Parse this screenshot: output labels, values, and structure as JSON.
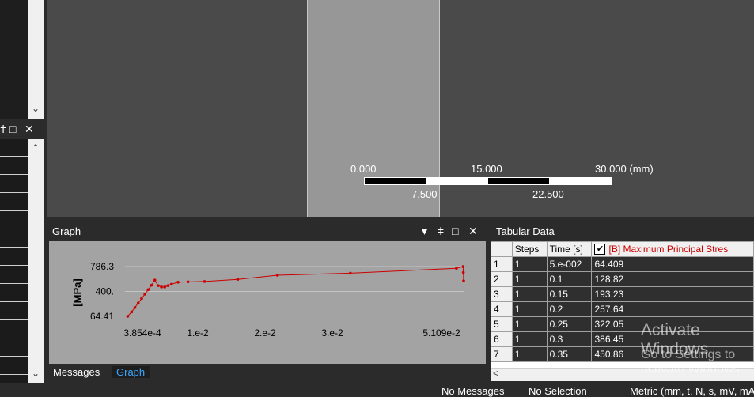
{
  "scale_bar": {
    "top_labels": [
      "0.000",
      "15.000",
      "30.000 (mm)"
    ],
    "bottom_labels": [
      "7.500",
      "22.500"
    ]
  },
  "graph_panel": {
    "title": "Graph",
    "controls": [
      "▾",
      "ǂ",
      "□",
      "✕"
    ],
    "tabs": [
      "Messages",
      "Graph"
    ]
  },
  "left_panel": {
    "controls": [
      "ǂ",
      "□",
      "✕"
    ],
    "scroll_down": "⌄",
    "scroll_up": "⌃"
  },
  "chart_data": {
    "type": "line",
    "ylabel": "[MPa]",
    "y_ticks": [
      "786.3",
      "400.",
      "64.41"
    ],
    "x_ticks": [
      "3.854e-4",
      "1.e-2",
      "2.e-2",
      "3.e-2",
      "5.109e-2"
    ],
    "xlim": [
      0.0,
      0.05109
    ],
    "ylim": [
      64.41,
      786.3
    ],
    "color": "#cc0000",
    "series": [
      {
        "x": [
          0.0004,
          0.001,
          0.0015,
          0.002,
          0.0025,
          0.003,
          0.0035,
          0.004,
          0.0045,
          0.005,
          0.0055,
          0.006,
          0.0065,
          0.007,
          0.008,
          0.0095,
          0.012,
          0.017,
          0.023,
          0.034,
          0.05,
          0.051,
          0.05105,
          0.05109
        ],
        "y": [
          64.4,
          128.8,
          193.2,
          257.6,
          322.1,
          386.5,
          450.9,
          515.3,
          590.0,
          510.0,
          490.0,
          490.0,
          510.0,
          530.0,
          560.0,
          565.0,
          570.0,
          600.0,
          660.0,
          690.0,
          760.0,
          786.3,
          700.0,
          580.0
        ]
      }
    ]
  },
  "tabular_panel": {
    "title": "Tabular Data",
    "headers": [
      "Steps",
      "Time [s]",
      "[B] Maximum Principal Stres"
    ],
    "checkbox": "✔",
    "rows": [
      {
        "n": "1",
        "step": "1",
        "time": "5.e-002",
        "value": "64.409"
      },
      {
        "n": "2",
        "step": "1",
        "time": "0.1",
        "value": "128.82"
      },
      {
        "n": "3",
        "step": "1",
        "time": "0.15",
        "value": "193.23"
      },
      {
        "n": "4",
        "step": "1",
        "time": "0.2",
        "value": "257.64"
      },
      {
        "n": "5",
        "step": "1",
        "time": "0.25",
        "value": "322.05"
      },
      {
        "n": "6",
        "step": "1",
        "time": "0.3",
        "value": "386.45"
      },
      {
        "n": "7",
        "step": "1",
        "time": "0.35",
        "value": "450.86"
      }
    ],
    "scroll_left": "<"
  },
  "watermark": {
    "line1": "Activate Windows",
    "line2": "Go to Settings to activate Windows."
  },
  "status_bar": {
    "messages": "No Messages",
    "selection": "No Selection",
    "units": "Metric (mm, t, N, s, mV, mA)"
  }
}
